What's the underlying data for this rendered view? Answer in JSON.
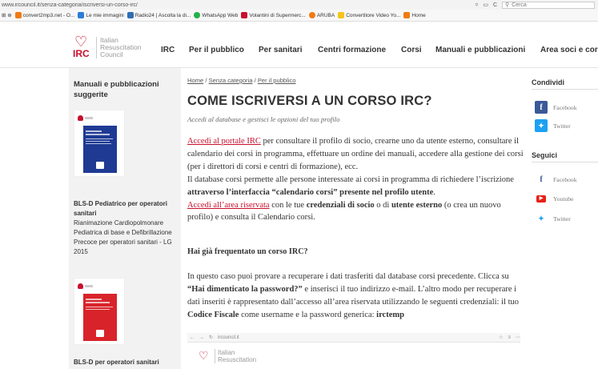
{
  "browser": {
    "url": "www.ircouncil.it/senza-categoria/iscriversi-un-corso-irc/",
    "search_placeholder": "Cerca",
    "bookmarks": [
      {
        "label": "convert2mp3.net - O...",
        "color": "#f07b12"
      },
      {
        "label": "Le mie immagini",
        "color": "#2c7bd6"
      },
      {
        "label": "Radio24 | Ascolta la di...",
        "color": "#2f6eb4"
      },
      {
        "label": "WhatsApp Web",
        "color": "#25b049"
      },
      {
        "label": "Volantini di Supermerc...",
        "color": "#c8102e"
      },
      {
        "label": "ARUBA",
        "color": "#f07b12"
      },
      {
        "label": "Convertitore Video Yo...",
        "color": "#f5c518"
      },
      {
        "label": "Home",
        "color": "#f07b12"
      }
    ]
  },
  "brand": {
    "line1": "Italian",
    "line2": "Resuscitation",
    "line3": "Council",
    "abbr": "IRC",
    "color": "#c8102e"
  },
  "nav": {
    "items": [
      "IRC",
      "Per il pubblico",
      "Per sanitari",
      "Centri formazione",
      "Corsi",
      "Manuali e pubblicazioni",
      "Area soci e corsi"
    ]
  },
  "sidebar": {
    "title": "Manuali e pubblicazioni suggerite",
    "book1": {
      "title": "BLS-D Pediatrico per operatori sanitari",
      "description": "Rianimazione Cardiopolmonare Pediatrica di base e Defibrillazione Precoce per operatori sanitari - LG 2015",
      "cover_color": "#1f3a93"
    },
    "book2": {
      "title": "BLS-D per operatori sanitari",
      "cover_color": "#d8232a"
    }
  },
  "main": {
    "breadcrumb": {
      "home": "Home",
      "sep": " / ",
      "cat": "Senza categoria",
      "page": "Per il pubblico"
    },
    "title": "COME ISCRIVERSI A UN CORSO IRC?",
    "subtitle": "Accedi al database e gestisci le opzioni del tuo profilo",
    "p1": {
      "link1": "Accedi al portale IRC",
      "t1": " per consultare il profilo di socio, crearne uno da utente esterno, consultare il calendario dei corsi in programma, effettuare un ordine dei manuali, accedere alla gestione dei corsi (per i direttori di corsi e centri di formazione), ecc.",
      "t2": "Il database corsi permette alle persone interessate ai corsi in programma di richiedere l’iscrizione ",
      "b1": "attraverso l’interfaccia “calendario corsi” presente nel profilo utente",
      "t3": ".",
      "link2": "Accedi all’area riservata",
      "t4": " con le tue ",
      "b2": "credenziali di socio",
      "t5": " o di ",
      "b3": "utente esterno",
      "t6": " (o crea un nuovo profilo) e consulta il Calendario corsi."
    },
    "question": "Hai già frequentato un corso IRC?",
    "p2": {
      "t1": "In questo caso puoi provare a recuperare i dati trasferiti dal database corsi precedente. Clicca su ",
      "b1": "“Hai dimenticato la password?”",
      "t2": " e inserisci il tuo indirizzo e-mail. L’altro modo per recuperare i dati inseriti è rappresentato dall’accesso all’area riservata utilizzando le seguenti credenziali: il tuo ",
      "b2": "Codice Fiscale",
      "t3": " come username e la password generica: ",
      "b3": "irctemp"
    },
    "embedded": {
      "url": "ircouncil.it",
      "line1": "Italian",
      "line2": "Resuscitation"
    }
  },
  "right": {
    "share_title": "Condividi",
    "share": [
      {
        "label": "Facebook",
        "icon": "facebook-icon",
        "color": "#3b5998"
      },
      {
        "label": "Twitter",
        "icon": "twitter-icon",
        "color": "#1da1f2"
      }
    ],
    "follow_title": "Seguici",
    "follow": [
      {
        "label": "Facebook",
        "icon": "facebook-icon",
        "color": "#3b5998"
      },
      {
        "label": "Youtube",
        "icon": "youtube-icon",
        "color": "#e62117"
      },
      {
        "label": "Twitter",
        "icon": "twitter-icon",
        "color": "#1da1f2"
      }
    ]
  }
}
